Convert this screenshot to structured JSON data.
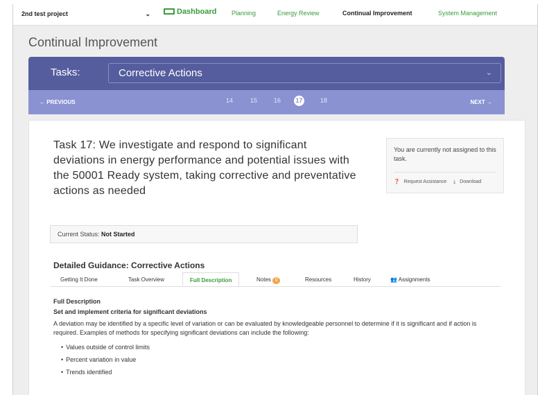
{
  "navbar": {
    "project": "2nd test project",
    "links": [
      {
        "label": "Dashboard"
      },
      {
        "label": "Planning"
      },
      {
        "label": "Energy Review"
      },
      {
        "label": "Continual Improvement"
      },
      {
        "label": "System Management"
      }
    ]
  },
  "page": {
    "title": "Continual Improvement"
  },
  "tasks": {
    "label": "Tasks:",
    "selected": "Corrective Actions"
  },
  "pager": {
    "previous": "← PREVIOUS",
    "next": "NEXT →",
    "pages": [
      "14",
      "15",
      "16",
      "17",
      "18"
    ],
    "current": "17"
  },
  "task": {
    "heading": "Task 17: We investigate and respond to significant deviations in energy performance and potential issues with the 50001 Ready system, taking corrective and preventative actions as needed",
    "status_label": "Current Status:",
    "status_value": "Not Started"
  },
  "assignment": {
    "message": "You are currently not assigned to this task.",
    "request_assistance": "Request Assistance",
    "download": "Download"
  },
  "guidance": {
    "title": "Detailed Guidance: Corrective Actions",
    "tabs": [
      {
        "label": "Getting It Done"
      },
      {
        "label": "Task Overview"
      },
      {
        "label": "Full Description"
      },
      {
        "label": "Notes"
      },
      {
        "label": "Resources"
      },
      {
        "label": "History"
      },
      {
        "label": "Assignments"
      }
    ],
    "active_tab": "Full Description",
    "notes_count": "0"
  },
  "content": {
    "heading": "Full Description",
    "subheading": "Set and implement criteria for significant deviations",
    "body": "A deviation may be identified by a specific level of variation or can be evaluated by knowledgeable personnel to determine if it is significant and if action is required. Examples of methods for specifying significant deviations can include the following:",
    "bullets": [
      "Values outside of control limits",
      "Percent variation in value",
      "Trends identified"
    ]
  },
  "colors": {
    "accent_green": "#3a9b3a",
    "tasks_bar": "#555d9e",
    "pager_bar": "#8a92d2",
    "notes_badge": "#f0a34a"
  }
}
